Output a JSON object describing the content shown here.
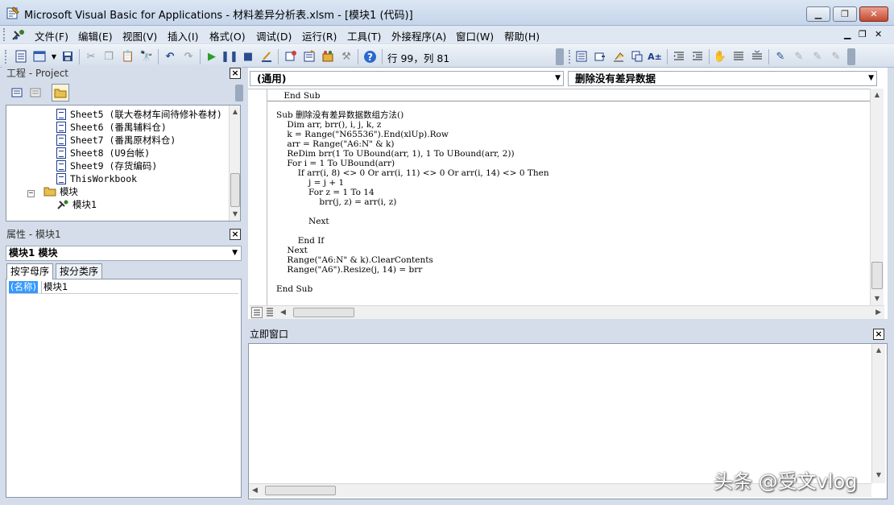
{
  "window": {
    "title": "Microsoft Visual Basic for Applications - 材料差异分析表.xlsm - [模块1 (代码)]",
    "minimize": "▁",
    "restore": "❐",
    "close": "✕"
  },
  "menubar": {
    "items": [
      {
        "label": "文件(F)"
      },
      {
        "label": "编辑(E)"
      },
      {
        "label": "视图(V)"
      },
      {
        "label": "插入(I)"
      },
      {
        "label": "格式(O)"
      },
      {
        "label": "调试(D)"
      },
      {
        "label": "运行(R)"
      },
      {
        "label": "工具(T)"
      },
      {
        "label": "外接程序(A)"
      },
      {
        "label": "窗口(W)"
      },
      {
        "label": "帮助(H)"
      }
    ],
    "mdi_min": "▁",
    "mdi_restore": "❐",
    "mdi_close": "✕"
  },
  "toolbar": {
    "position": "行 99，列 81"
  },
  "project": {
    "title": "工程 - Project",
    "items": [
      {
        "label": "Sheet5 (联大卷材车间待修补卷材)"
      },
      {
        "label": "Sheet6 (番禺辅料仓)"
      },
      {
        "label": "Sheet7 (番禺原材料仓)"
      },
      {
        "label": "Sheet8 (U9台帐)"
      },
      {
        "label": "Sheet9 (存货编码)"
      },
      {
        "label": "ThisWorkbook"
      },
      {
        "label": "模块"
      },
      {
        "label": "模块1"
      }
    ]
  },
  "properties": {
    "title": "属性 - 模块1",
    "object": "模块1 模块",
    "tabs": [
      "按字母序",
      "按分类序"
    ],
    "rows": [
      {
        "name": "(名称)",
        "value": "模块1"
      }
    ]
  },
  "code": {
    "object_combo": "(通用)",
    "proc_combo": "删除没有差异数据",
    "lines": [
      "    End Sub",
      "",
      "Sub 删除没有差异数据数组方法()",
      "    Dim arr, brr(), i, j, k, z",
      "    k = Range(\"N65536\").End(xlUp).Row",
      "    arr = Range(\"A6:N\" & k)",
      "    ReDim brr(1 To UBound(arr, 1), 1 To UBound(arr, 2))",
      "    For i = 1 To UBound(arr)",
      "        If arr(i, 8) <> 0 Or arr(i, 11) <> 0 Or arr(i, 14) <> 0 Then",
      "            j = j + 1",
      "            For z = 1 To 14",
      "                brr(j, z) = arr(i, z)",
      "",
      "            Next",
      "",
      "        End If",
      "    Next",
      "    Range(\"A6:N\" & k).ClearContents",
      "    Range(\"A6\").Resize(j, 14) = brr",
      "",
      "End Sub"
    ]
  },
  "immediate": {
    "title": "立即窗口"
  },
  "watermark": "头条 @受文vlog"
}
